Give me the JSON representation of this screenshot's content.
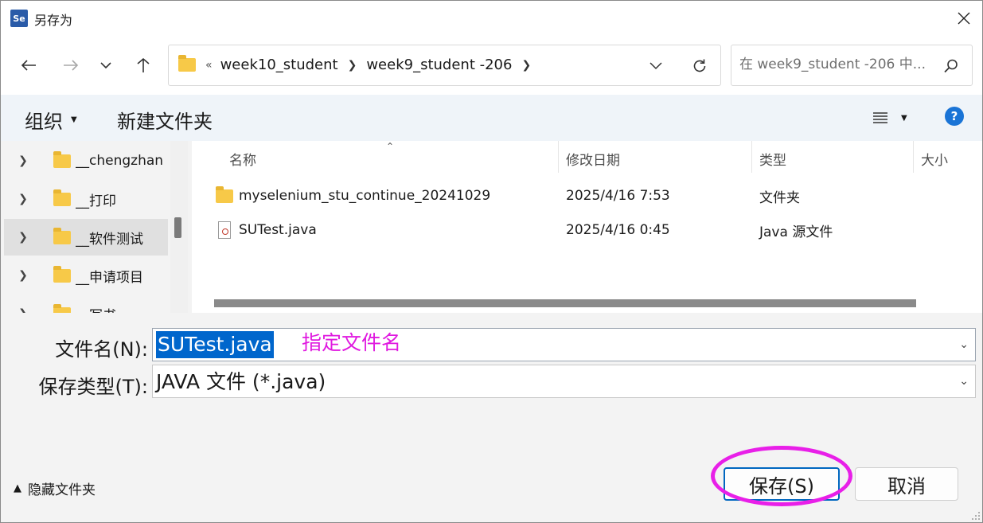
{
  "window": {
    "title": "另存为",
    "app_icon_text": "Se"
  },
  "nav": {
    "breadcrumb_overflow": "«",
    "breadcrumb": [
      "week10_student",
      "week9_student -206"
    ],
    "search_placeholder": "在 week9_student -206 中..."
  },
  "toolbar": {
    "organize_label": "组织",
    "new_folder_label": "新建文件夹",
    "help_label": "?"
  },
  "tree": {
    "items": [
      {
        "label": "__chengzhan"
      },
      {
        "label": "__打印"
      },
      {
        "label": "__软件测试"
      },
      {
        "label": "__申请项目"
      },
      {
        "label": "__写书"
      }
    ]
  },
  "file_list": {
    "columns": {
      "name": "名称",
      "modified": "修改日期",
      "type": "类型",
      "size": "大小"
    },
    "rows": [
      {
        "name": "myselenium_stu_continue_20241029",
        "modified": "2025/4/16 7:53",
        "type": "文件夹",
        "icon": "folder-icon"
      },
      {
        "name": "SUTest.java",
        "modified": "2025/4/16 0:45",
        "type": "Java 源文件",
        "icon": "java-file-icon"
      }
    ]
  },
  "form": {
    "filename_label": "文件名(N):",
    "filename_value": "SUTest.java",
    "filetype_label": "保存类型(T):",
    "filetype_value": "JAVA 文件 (*.java)",
    "annotation": "指定文件名"
  },
  "footer": {
    "hide_folders_label": "隐藏文件夹",
    "save_label": "保存(S)",
    "cancel_label": "取消"
  },
  "colors": {
    "accent": "#0067c0",
    "selection": "#0066cc",
    "annotation": "#e81fe8",
    "folder": "#f7c948"
  }
}
